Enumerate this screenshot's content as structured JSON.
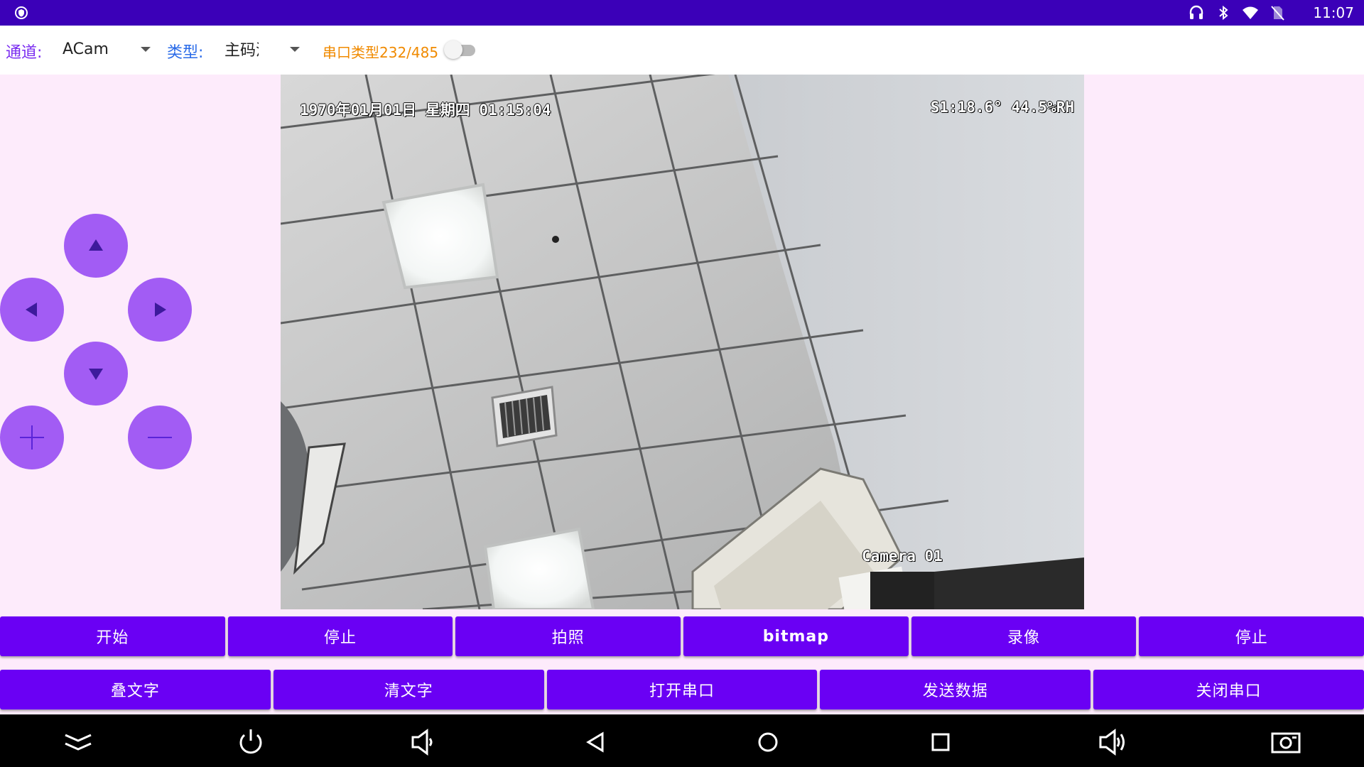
{
  "status_bar": {
    "time": "11:07",
    "icons": [
      "shield-icon",
      "headset-icon",
      "bluetooth-icon",
      "wifi-icon",
      "no-sim-icon"
    ]
  },
  "toolbar": {
    "channel_label": "通道:",
    "channel_value": "ACam",
    "type_label": "类型:",
    "type_value": "主码流",
    "serial_toggle_label": "串口类型232/485",
    "serial_toggle_on": false
  },
  "camera": {
    "osd_datetime": "1970年01月01日  星期四  01:15:04",
    "osd_sensor": "S1:18.6°   44.5%RH",
    "osd_camera_name": "Camera  01"
  },
  "ptz": [
    "up-arrow-icon",
    "left-arrow-icon",
    "right-arrow-icon",
    "down-arrow-icon",
    "zoom-in-icon",
    "zoom-out-icon"
  ],
  "buttons_row1": [
    "开始",
    "停止",
    "拍照",
    "bitmap",
    "录像",
    "停止"
  ],
  "buttons_row2": [
    "叠文字",
    "清文字",
    "打开串口",
    "发送数据",
    "关闭串口"
  ],
  "nav_bar": [
    "collapse-icon",
    "power-icon",
    "volume-down-icon",
    "back-icon",
    "home-icon",
    "recents-icon",
    "volume-up-icon",
    "screenshot-icon"
  ],
  "colors": {
    "status_bar": "#3b00b8",
    "accent_button": "#6a00f4",
    "ptz_button": "#a25cf4",
    "background": "#fdebfb"
  }
}
